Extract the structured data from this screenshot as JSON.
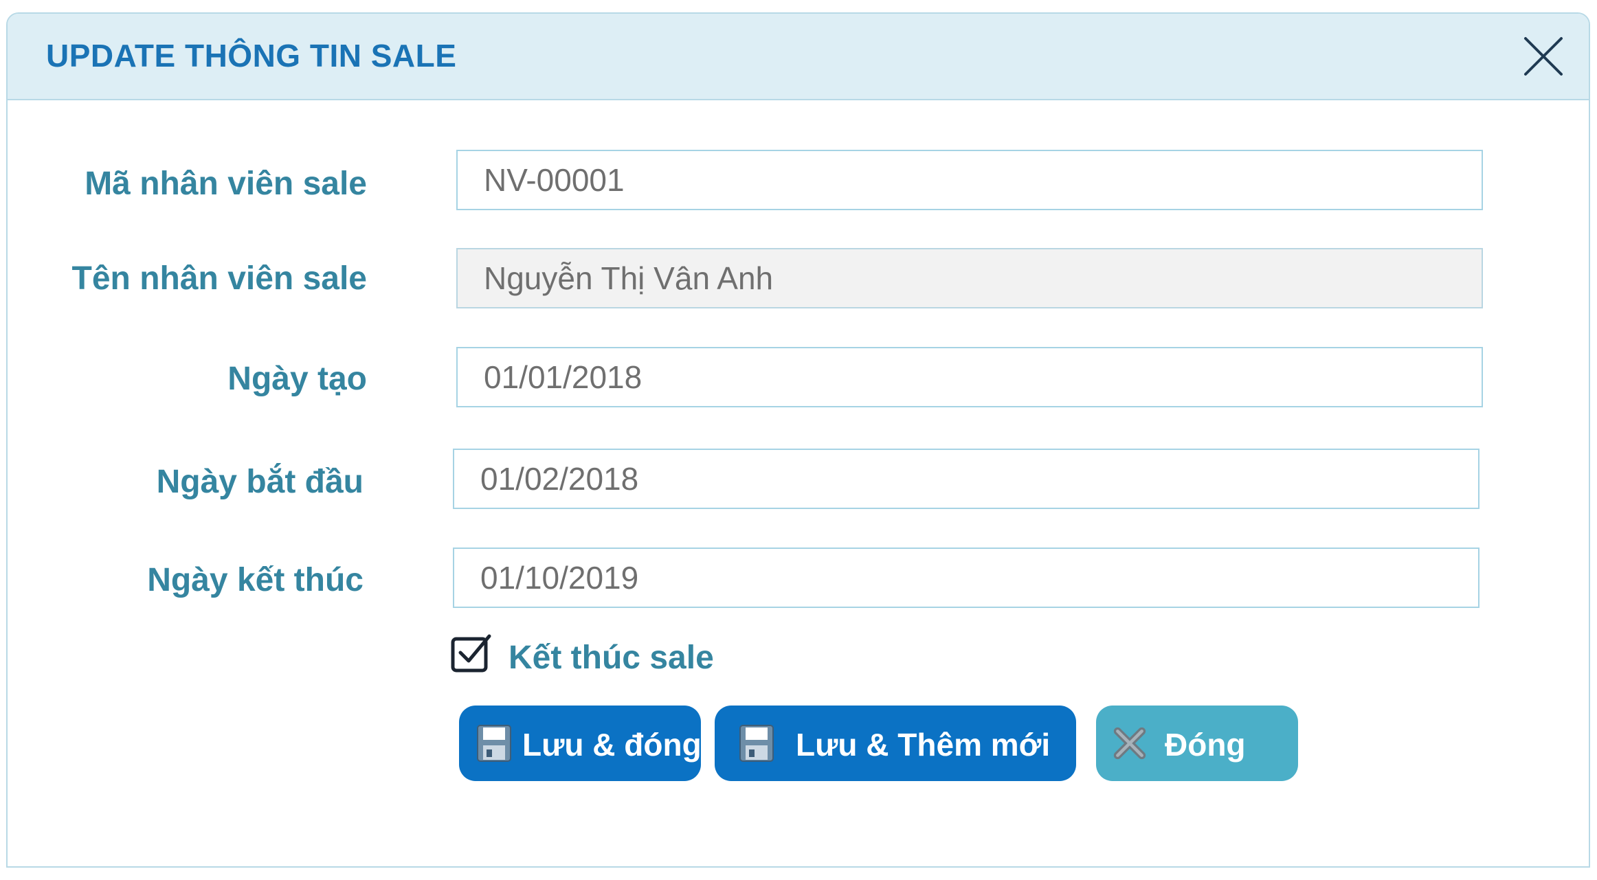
{
  "dialog": {
    "title": "UPDATE THÔNG TIN SALE",
    "close_icon": "close-icon"
  },
  "form": {
    "employee_code": {
      "label": "Mã nhân viên sale",
      "value": "NV-00001"
    },
    "employee_name": {
      "label": "Tên nhân viên sale",
      "value": "Nguyễn Thị Vân Anh"
    },
    "created_date": {
      "label": "Ngày tạo",
      "value": "01/01/2018"
    },
    "start_date": {
      "label": "Ngày bắt đầu",
      "value": "01/02/2018"
    },
    "end_date": {
      "label": "Ngày kết thúc",
      "value": "01/10/2019"
    },
    "end_sale": {
      "label": "Kết thúc sale",
      "checked": true
    }
  },
  "actions": {
    "save_close": {
      "label": "Lưu & đóng",
      "icon": "floppy-disk-icon"
    },
    "save_new": {
      "label": "Lưu & Thêm mới",
      "icon": "floppy-disk-icon"
    },
    "close": {
      "label": "Đóng",
      "icon": "x-icon"
    }
  },
  "colors": {
    "title": "#1a73b5",
    "label": "#3585a0",
    "primary_button": "#0b72c4",
    "secondary_button": "#4bafc8",
    "header_bg": "#ddeef5",
    "field_border": "#a6d3e4"
  }
}
